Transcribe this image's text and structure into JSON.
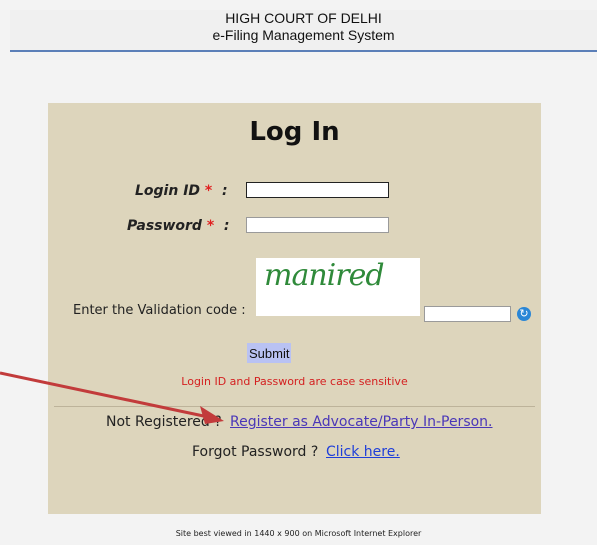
{
  "header": {
    "line1": "HIGH COURT OF DELHI",
    "line2": "e-Filing Management System"
  },
  "login": {
    "title": "Log In",
    "login_id_label": "Login ID",
    "password_label": "Password",
    "required_mark": "*",
    "colon": ":",
    "login_id_value": "",
    "password_value": ""
  },
  "validation": {
    "label": "Enter the Validation code :",
    "captcha_text": "manired",
    "input_value": "",
    "refresh_icon": "refresh-icon"
  },
  "actions": {
    "submit_label": "Submit",
    "case_note": "Login ID and Password are case sensitive"
  },
  "registration": {
    "not_registered": "Not Registered ?",
    "register_link": "Register as Advocate/Party In-Person.",
    "forgot_text": "Forgot Password ?",
    "click_here": "Click here."
  },
  "footer": {
    "text": "Site best viewed in 1440 x 900 on Microsoft Internet Explorer"
  },
  "colors": {
    "card_bg": "#ddd5bc",
    "header_rule": "#5b7fb8",
    "required": "#e02020",
    "link": "#4a37b8",
    "annotation_arrow": "#c23b3b"
  }
}
